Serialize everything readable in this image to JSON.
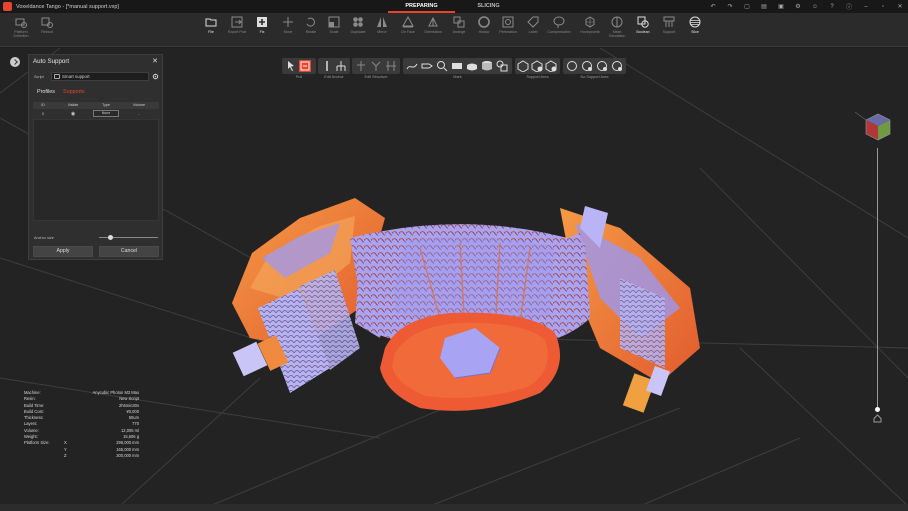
{
  "window": {
    "title": "Voxeldance Tango - [*manual support.vxp]",
    "mode_tabs": [
      {
        "label": "PREPARING",
        "active": true
      },
      {
        "label": "SLICING",
        "active": false
      }
    ]
  },
  "toolbar": {
    "items": [
      {
        "label": "Platform Definition",
        "icon": "platform-icon"
      },
      {
        "label": "Reboot",
        "icon": "reboot-icon"
      },
      {
        "label": "File",
        "icon": "folder-icon"
      },
      {
        "label": "Export Part",
        "icon": "export-icon"
      },
      {
        "label": "Fix",
        "icon": "fix-plus-icon"
      },
      {
        "label": "Move",
        "icon": "move-icon"
      },
      {
        "label": "Rotate",
        "icon": "rotate-icon"
      },
      {
        "label": "Scale",
        "icon": "scale-icon"
      },
      {
        "label": "Duplicate",
        "icon": "duplicate-icon"
      },
      {
        "label": "Mirror",
        "icon": "mirror-icon"
      },
      {
        "label": "On Face",
        "icon": "on-face-icon"
      },
      {
        "label": "Orientation",
        "icon": "orientation-icon"
      },
      {
        "label": "Arrange",
        "icon": "arrange-icon"
      },
      {
        "label": "Hollow",
        "icon": "hollow-icon"
      },
      {
        "label": "Perforation",
        "icon": "perforation-icon"
      },
      {
        "label": "Label",
        "icon": "label-icon"
      },
      {
        "label": "Compensation",
        "icon": "compensation-icon"
      },
      {
        "label": "Honeycomb",
        "icon": "honeycomb-icon"
      },
      {
        "label": "Mesh Simulation",
        "icon": "mesh-simulation-icon"
      },
      {
        "label": "Boolean",
        "icon": "boolean-icon"
      },
      {
        "label": "Support",
        "icon": "support-icon"
      },
      {
        "label": "Slice",
        "icon": "slice-icon"
      }
    ]
  },
  "support_toolbar": {
    "groups": [
      {
        "label": "Pull"
      },
      {
        "label": "Edit Anchor"
      },
      {
        "label": "Edit Structure"
      },
      {
        "label": "Mark"
      },
      {
        "label": "Support Area"
      },
      {
        "label": "No Support Area"
      }
    ]
  },
  "auto_support": {
    "title": "Auto Support",
    "script_label": "Script",
    "script_value": "Smart support",
    "tabs": [
      {
        "label": "Profiles",
        "active": false
      },
      {
        "label": "Supports",
        "active": true
      }
    ],
    "table": {
      "columns": [
        "ID",
        "Visible",
        "Type",
        "Volume"
      ],
      "rows": [
        {
          "id": "0",
          "visible_icon": "eye-icon",
          "type": "None",
          "volume": "-"
        }
      ]
    },
    "anchor_size_label": "Anchor size",
    "anchor_size_level": 0.2,
    "apply_label": "Apply",
    "cancel_label": "Cancel"
  },
  "machine_info": [
    {
      "key": "Machine:",
      "value": "Anycubic Photon M3 Max"
    },
    {
      "key": "Resin:",
      "value": "New Script"
    },
    {
      "key": "Build Time:",
      "value": "2h6min30s"
    },
    {
      "key": "Build Cost:",
      "value": "¥0,000"
    },
    {
      "key": "Thickness:",
      "value": "50um"
    },
    {
      "key": "Layers:",
      "value": "770"
    },
    {
      "key": "Volume:",
      "value": "12,005 ml"
    },
    {
      "key": "Weight:",
      "value": "15,606 g"
    },
    {
      "key": "Platform Size:",
      "axis": "X",
      "value": "298,000 mm"
    },
    {
      "key": "",
      "axis": "Y",
      "value": "165,000 mm"
    },
    {
      "key": "",
      "axis": "Z",
      "value": "300,000 mm"
    }
  ],
  "colors": {
    "accent": "#e8432d",
    "background": "#232323",
    "model_orange": "#f07a3a",
    "model_violet": "#9c97f0"
  }
}
